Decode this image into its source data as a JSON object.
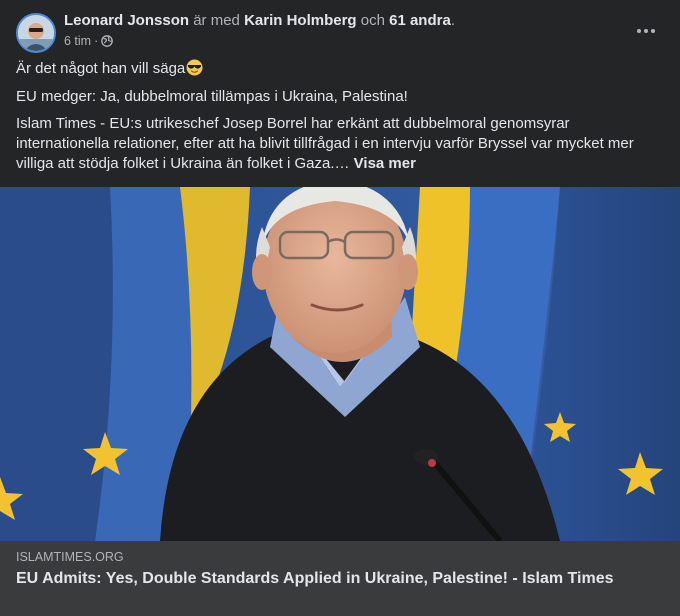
{
  "header": {
    "author": "Leonard Jonsson",
    "with_text": "är med",
    "tagged": "Karin Holmberg",
    "and_text": "och",
    "others": "61 andra",
    "period": ".",
    "time": "6 tim",
    "separator": "·",
    "privacy_icon": "globe-icon",
    "menu_icon": "more-dots-icon"
  },
  "body": {
    "line1": "Är det något han vill säga",
    "line1_emoji": "sunglasses-emoji",
    "line2": "EU medger: Ja, dubbelmoral tillämpas i Ukraina, Palestina!",
    "line3": "Islam Times - EU:s utrikeschef Josep Borrel har erkänt att dubbelmoral genomsyrar internationella relationer, efter att ha blivit tillfrågad i en intervju varför Bryssel var mycket mer villiga att stödja folket i Ukraina än folket i Gaza.…",
    "see_more": "Visa mer"
  },
  "link_preview": {
    "domain": "ISLAMTIMES.ORG",
    "title": "EU Admits: Yes, Double Standards Applied in Ukraine, Palestine! - Islam Times"
  },
  "colors": {
    "background": "#242526",
    "link_box": "#3a3b3c",
    "text_primary": "#e4e6eb",
    "text_secondary": "#b0b3b8"
  }
}
